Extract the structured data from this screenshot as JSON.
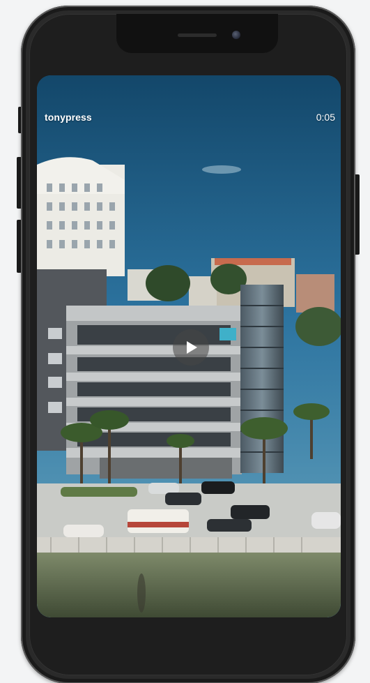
{
  "post": {
    "username": "tonypress",
    "duration": "0:05"
  },
  "video": {
    "state": "paused",
    "scene": "aerial-city-office-building"
  },
  "icons": {
    "play": "play-icon"
  },
  "colors": {
    "sky_top": "#1a5a83",
    "sky_bottom": "#5e9cb9",
    "phone_frame": "#2a2a2a",
    "overlay_text": "#ffffff"
  }
}
